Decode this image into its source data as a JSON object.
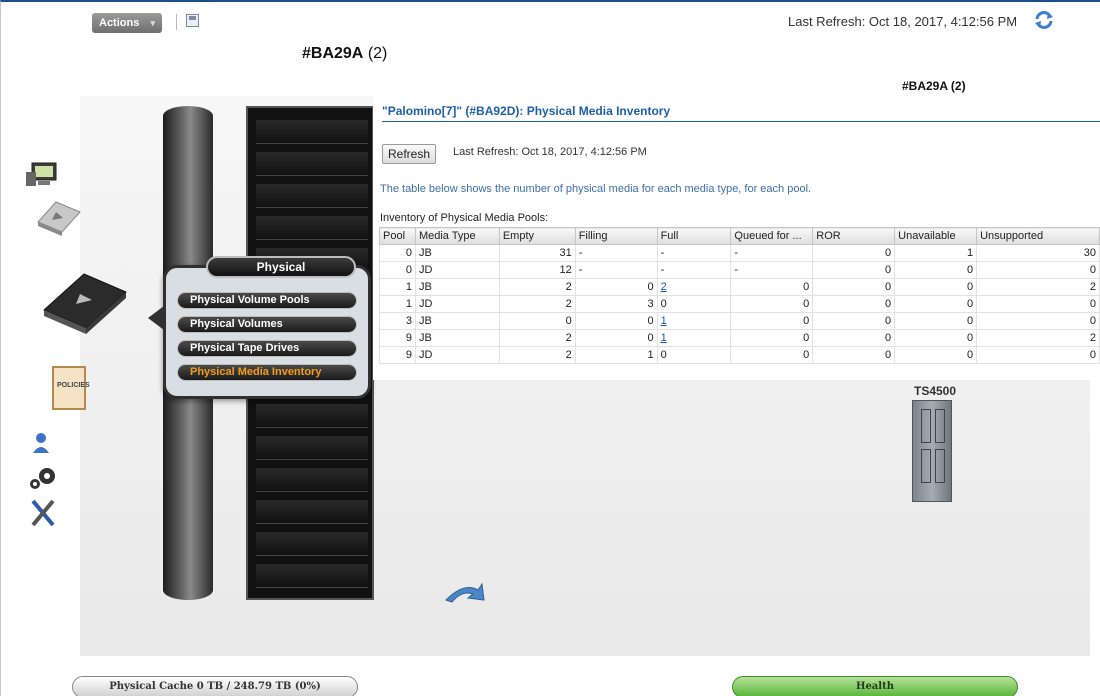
{
  "toolbar": {
    "actions_label": "Actions",
    "actions_caret": "▾",
    "save_icon": "save-icon",
    "last_refresh": "Last Refresh:  Oct 18, 2017, 4:12:56 PM",
    "refresh_icon": "refresh-icon"
  },
  "system": {
    "name": "#BA29A",
    "count": "(2)",
    "small_label": "#BA29A (2)"
  },
  "left_nav": {
    "icons": [
      "monitor-icon",
      "cache-icon",
      "physical-tape-icon",
      "policies-icon",
      "user-icon",
      "settings-gears-icon",
      "tools-icon"
    ],
    "policies_label": "POLICIES"
  },
  "physical_menu": {
    "title": "Physical",
    "items": [
      {
        "label": "Physical Volume Pools",
        "active": false
      },
      {
        "label": "Physical Volumes",
        "active": false
      },
      {
        "label": "Physical Tape Drives",
        "active": false
      },
      {
        "label": "Physical Media Inventory",
        "active": true
      }
    ]
  },
  "inventory": {
    "title": "\"Palomino[7]\" (#BA92D): Physical Media Inventory",
    "refresh_button": "Refresh",
    "last_refresh": "Last Refresh:  Oct 18, 2017, 4:12:56 PM",
    "description": "The table below shows the number of physical media for each media type, for each pool.",
    "caption": "Inventory of Physical Media Pools:",
    "columns": [
      "Pool",
      "Media Type",
      "Empty",
      "Filling",
      "Full",
      "Queued for ...",
      "ROR",
      "Unavailable",
      "Unsupported"
    ],
    "rows": [
      {
        "pool": "0",
        "media_type": "JB",
        "empty": "31",
        "filling": "-",
        "full": "-",
        "queued": "-",
        "ror": "0",
        "unavailable": "1",
        "unsupported": "30",
        "full_link": false
      },
      {
        "pool": "0",
        "media_type": "JD",
        "empty": "12",
        "filling": "-",
        "full": "-",
        "queued": "-",
        "ror": "0",
        "unavailable": "0",
        "unsupported": "0",
        "full_link": false
      },
      {
        "pool": "1",
        "media_type": "JB",
        "empty": "2",
        "filling": "0",
        "full": "2",
        "queued": "0",
        "ror": "0",
        "unavailable": "0",
        "unsupported": "2",
        "full_link": true
      },
      {
        "pool": "1",
        "media_type": "JD",
        "empty": "2",
        "filling": "3",
        "full": "0",
        "queued": "0",
        "ror": "0",
        "unavailable": "0",
        "unsupported": "0",
        "full_link": false
      },
      {
        "pool": "3",
        "media_type": "JB",
        "empty": "0",
        "filling": "0",
        "full": "1",
        "queued": "0",
        "ror": "0",
        "unavailable": "0",
        "unsupported": "0",
        "full_link": true
      },
      {
        "pool": "9",
        "media_type": "JB",
        "empty": "2",
        "filling": "0",
        "full": "1",
        "queued": "0",
        "ror": "0",
        "unavailable": "0",
        "unsupported": "2",
        "full_link": true
      },
      {
        "pool": "9",
        "media_type": "JD",
        "empty": "2",
        "filling": "1",
        "full": "0",
        "queued": "0",
        "ror": "0",
        "unavailable": "0",
        "unsupported": "0",
        "full_link": false
      }
    ]
  },
  "library": {
    "label": "TS4500"
  },
  "status_bar": {
    "cache_label": "Physical Cache 0 TB / 248.79 TB (0%)",
    "health_label": "Health",
    "health_color": "#57b439"
  }
}
